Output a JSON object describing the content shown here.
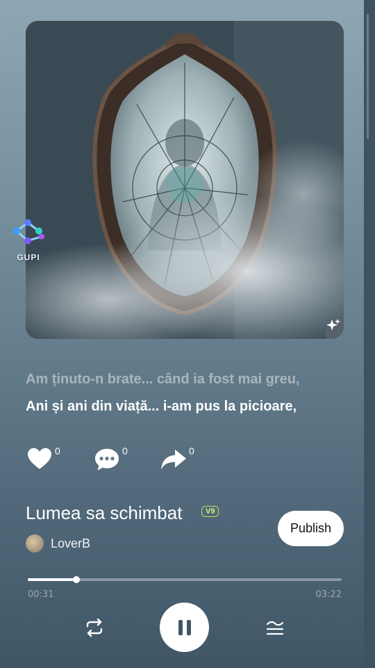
{
  "cover": {
    "art_description_icon": "broken-mirror-artwork",
    "sparkle_icon": "sparkle-icon"
  },
  "watermark": {
    "text": "GUPI"
  },
  "lyrics": {
    "previous": "Am ținuto-n brate... când ia fost mai greu,",
    "current": "Ani și ani din viață... i-am pus la picioare,"
  },
  "actions": {
    "likes": "0",
    "comments": "0",
    "shares": "0"
  },
  "song": {
    "title": "Lumea sa schimbat",
    "version": "V9",
    "author": "LoverB",
    "publish_label": "Publish"
  },
  "player": {
    "current_time": "00:31",
    "total_time": "03:22",
    "progress": 0.155,
    "state": "playing"
  },
  "colors": {
    "accent_badge": "#c4e066",
    "background_top": "#8fa7b4",
    "background_bottom": "#3f5666"
  }
}
